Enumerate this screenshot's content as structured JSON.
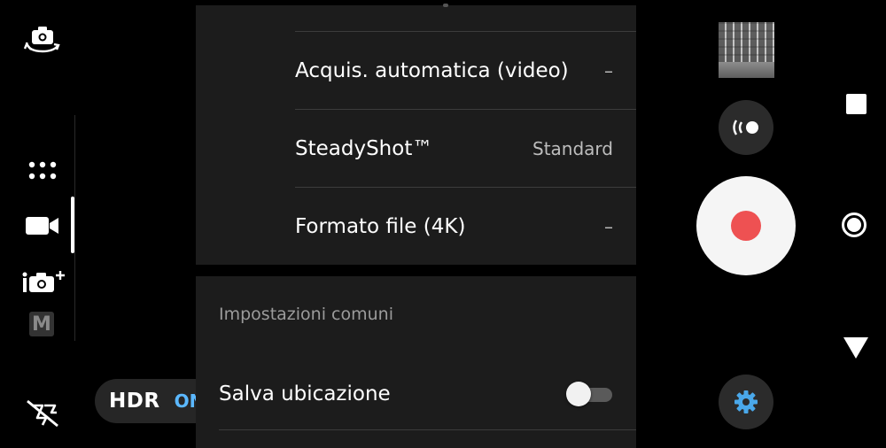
{
  "left_rail": {
    "icons": [
      "switch-camera-icon",
      "apps-grid-icon",
      "video-mode-icon",
      "intelligent-auto-plus-icon",
      "manual-mode-icon",
      "flash-off-icon"
    ],
    "active_mode": "video",
    "manual_label": "M",
    "plus_label": "+"
  },
  "hdr": {
    "label": "HDR",
    "state": "ON",
    "state_color": "#5bb8ff"
  },
  "settings": {
    "rows": [
      {
        "label": "Acquis. automatica (video)",
        "value": "–"
      },
      {
        "label": "SteadyShot™",
        "value": "Standard"
      },
      {
        "label": "Formato file (4K)",
        "value": "–"
      }
    ],
    "common_section": {
      "title": "Impostazioni comuni",
      "rows": [
        {
          "label": "Salva ubicazione",
          "toggle": false
        }
      ]
    }
  },
  "right_controls": {
    "icons": [
      "gallery-thumbnail",
      "steadyshot-effect-icon",
      "record-button",
      "settings-gear-icon"
    ],
    "accent_color": "#4aa8ea",
    "record_color": "#ee5152"
  },
  "navigation": {
    "icons": [
      "recents-square-icon",
      "home-circle-icon",
      "back-triangle-icon"
    ]
  }
}
